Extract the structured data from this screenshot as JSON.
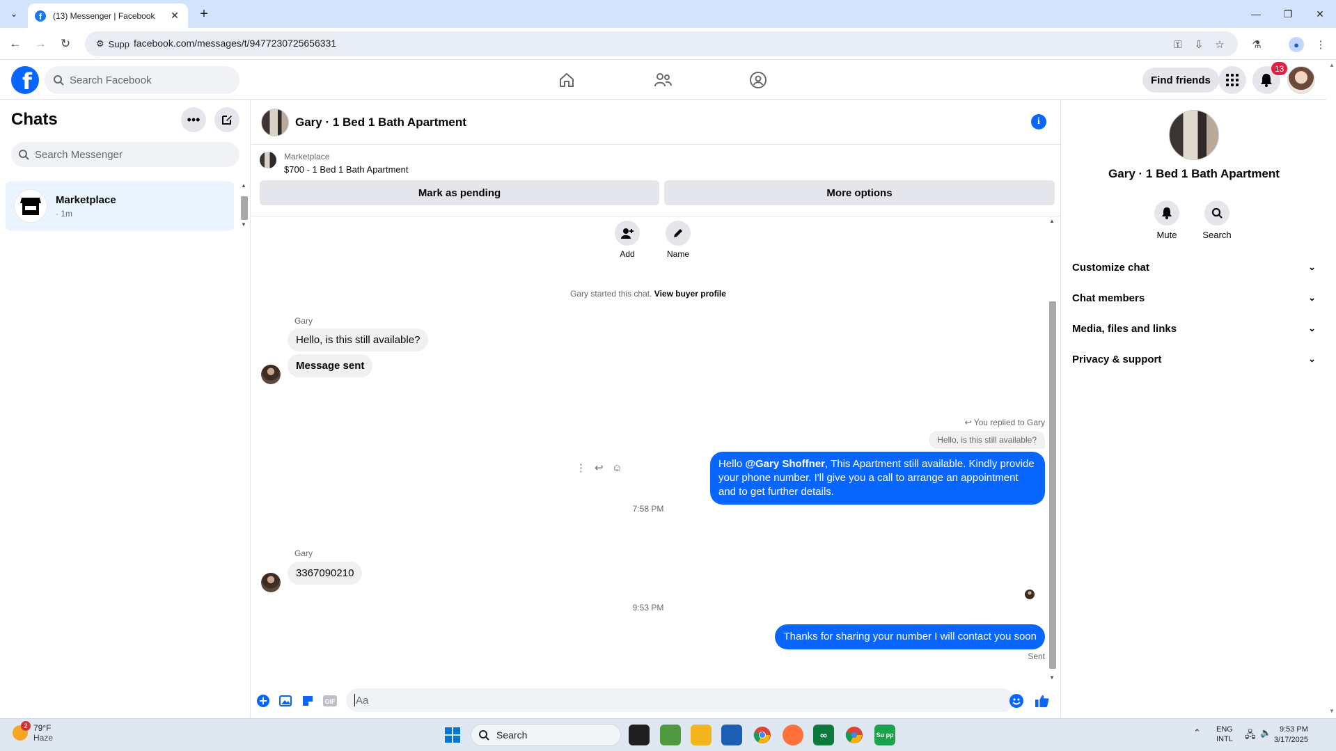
{
  "browser": {
    "tab_title": "(13) Messenger | Facebook",
    "site_chip": "Supp",
    "url": "facebook.com/messages/t/9477230725656331"
  },
  "fb_nav": {
    "search_placeholder": "Search Facebook",
    "find_friends": "Find friends",
    "notification_count": "13"
  },
  "chats": {
    "title": "Chats",
    "search_placeholder": "Search Messenger",
    "items": [
      {
        "name": "Marketplace",
        "time": "· 1m"
      }
    ]
  },
  "conversation": {
    "title": "Gary · 1 Bed 1 Bath Apartment",
    "marketplace_label": "Marketplace",
    "listing": "$700 - 1 Bed 1 Bath Apartment",
    "mark_pending": "Mark as pending",
    "more_options": "More options",
    "actions": {
      "add": "Add",
      "name": "Name"
    },
    "started_text": "Gary started this chat.",
    "view_buyer_profile": "View buyer profile",
    "messages": {
      "sender_1": "Gary",
      "in_1": "Hello, is this still available?",
      "in_2": "Message sent",
      "replied_note": "You replied to Gary",
      "quoted": "Hello, is this still available?",
      "out_1_prefix": "Hello ",
      "out_1_mention": "@Gary Shoffner",
      "out_1_suffix": ", This Apartment still available. Kindly provide your phone number. I'll give you a call to arrange an appointment and to get further details.",
      "time_1": "7:58 PM",
      "sender_2": "Gary",
      "in_3": "3367090210",
      "time_2": "9:53 PM",
      "out_2": "Thanks for sharing your number I will contact you soon",
      "status": "Sent"
    },
    "composer_placeholder": "Aa"
  },
  "details": {
    "name": "Gary · 1 Bed 1 Bath Apartment",
    "mute": "Mute",
    "search": "Search",
    "sections": [
      "Customize chat",
      "Chat members",
      "Media, files and links",
      "Privacy & support"
    ]
  },
  "taskbar": {
    "weather_temp": "79°F",
    "weather_desc": "Haze",
    "weather_badge": "2",
    "search_label": "Search",
    "lang_1": "ENG",
    "lang_2": "INTL",
    "time": "9:53 PM",
    "date": "3/17/2025",
    "active_app_label": "Su pp"
  },
  "colors": {
    "accent": "#0866ff",
    "tab_strip": "#d3e3fd",
    "bubble_in": "#f0f0f0",
    "badge": "#e41e3f"
  }
}
